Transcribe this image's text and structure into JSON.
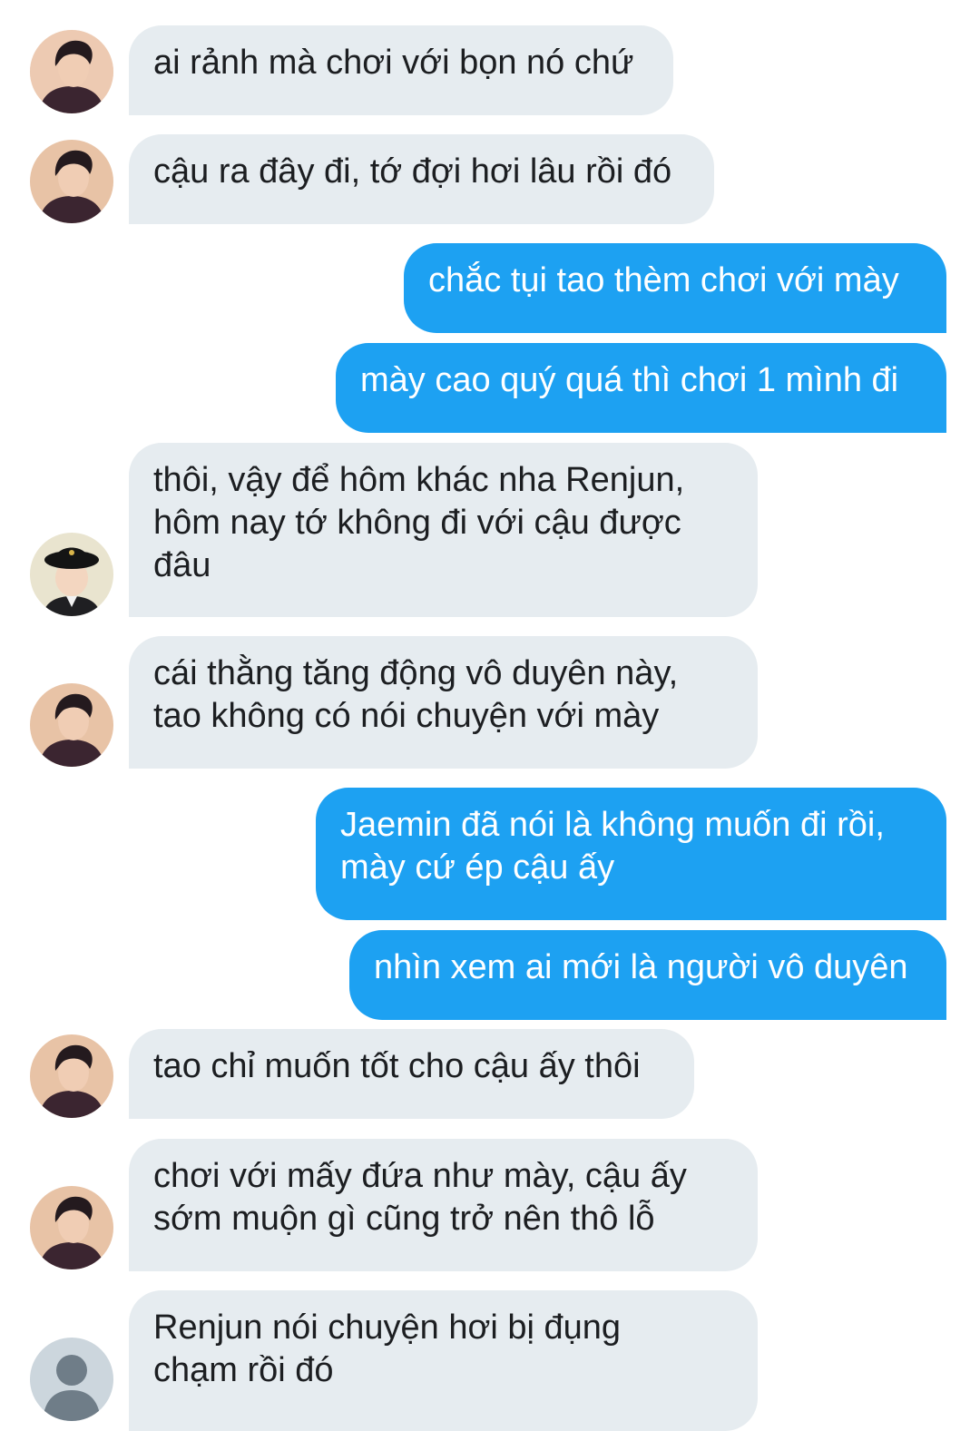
{
  "colors": {
    "incoming_bubble": "#e6ecf0",
    "outgoing_bubble": "#1da1f2",
    "incoming_text": "#1c1e21",
    "outgoing_text": "#ffffff"
  },
  "messages": [
    {
      "direction": "incoming",
      "sender_avatar": "avatar-boy-dark-shirt",
      "text": "ai rảnh mà chơi với bọn nó chứ"
    },
    {
      "direction": "incoming",
      "sender_avatar": "avatar-boy-dark-shirt",
      "text": "cậu ra đây đi, tớ đợi hơi lâu rồi đó"
    },
    {
      "direction": "outgoing",
      "text": "chắc tụi tao thèm chơi với mày"
    },
    {
      "direction": "outgoing",
      "text": "mày cao quý quá thì chơi 1 mình đi"
    },
    {
      "direction": "incoming",
      "sender_avatar": "avatar-boy-black-hat",
      "text": "thôi, vậy để hôm khác nha Renjun,\nhôm nay tớ không đi với cậu được\nđâu"
    },
    {
      "direction": "incoming",
      "sender_avatar": "avatar-boy-dark-shirt",
      "text": "cái thằng tăng động vô duyên này,\ntao không có nói chuyện với mày"
    },
    {
      "direction": "outgoing",
      "text": "Jaemin đã nói là không muốn đi rồi,\nmày cứ ép cậu ấy"
    },
    {
      "direction": "outgoing",
      "text": "nhìn xem ai mới là người vô duyên"
    },
    {
      "direction": "incoming",
      "sender_avatar": "avatar-boy-dark-shirt",
      "text": "tao chỉ muốn tốt cho cậu ấy thôi"
    },
    {
      "direction": "incoming",
      "sender_avatar": "avatar-boy-dark-shirt",
      "text": "chơi với mấy đứa như mày, cậu ấy\nsớm muộn gì cũng trở nên thô lỗ"
    },
    {
      "direction": "incoming",
      "sender_avatar": "default-avatar",
      "text": "Renjun nói chuyện hơi bị đụng\nchạm rồi đó"
    }
  ]
}
